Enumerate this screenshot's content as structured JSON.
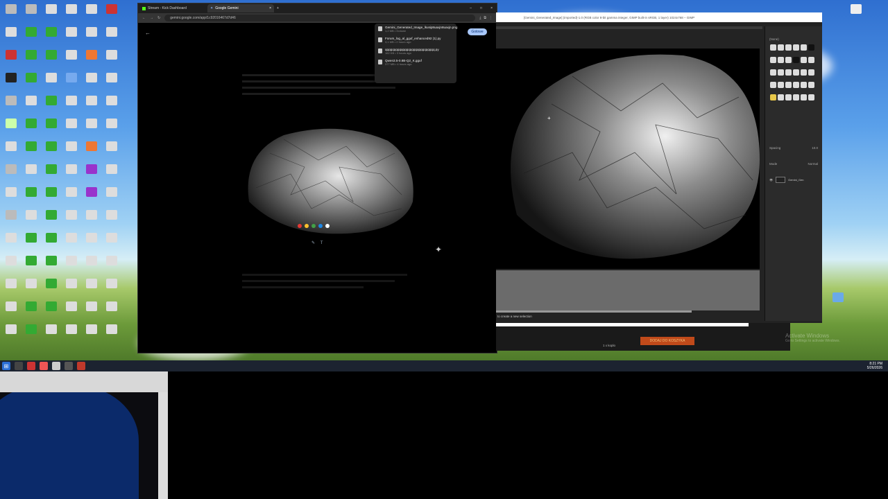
{
  "browser": {
    "tabs": [
      {
        "label": "Stream - Kick Dashboard"
      },
      {
        "label": "Google Gemini"
      }
    ],
    "url": "gemini.google.com/app/1c92016467d7d46",
    "done_button": "Gotowe"
  },
  "downloads": [
    {
      "name": "Gemini_Generated_Image_lkusip8uaxjn8uaxjn.png",
      "meta": "1,2 MB • Gotowe"
    },
    {
      "name": "Forum_log_al_gguf_enhanced92 (1).py",
      "meta": "3,1 MB • 2 hours ago"
    },
    {
      "name": "qqqqqqqqqqqqqqqqqqqqqqqqqqqq.py",
      "meta": "162 KB • 3 hours ago"
    },
    {
      "name": "Qwen3.5-0.8B-Q2_K.gguf",
      "meta": "377 MB • 4 hours ago"
    }
  ],
  "editor": {
    "title": "[Gemini_Generated_Image] (imported)-1.0 (RGB color 8-bit gamma integer, GIMP built-in sRGB, 1 layer) 1024x768 – GIMP",
    "status": "to create a new selection",
    "panel": {
      "brush_label": "(None)",
      "spacing_label": "Spacing",
      "spacing_value": "10.0",
      "mode_label": "Mode",
      "mode_value": "Normal",
      "layer_name": "Gemini_Gen"
    }
  },
  "web_below": {
    "button": "DODAJ DO KOSZYKA",
    "note": "1 x koplo"
  },
  "watermark": {
    "line1": "Activate Windows",
    "line2": "Go to Settings to activate Windows."
  },
  "clock": {
    "time": "8:21 PM",
    "date": "5/26/2026"
  },
  "colors": {
    "accent": "#a8c7fa",
    "button": "#c04a1a"
  }
}
